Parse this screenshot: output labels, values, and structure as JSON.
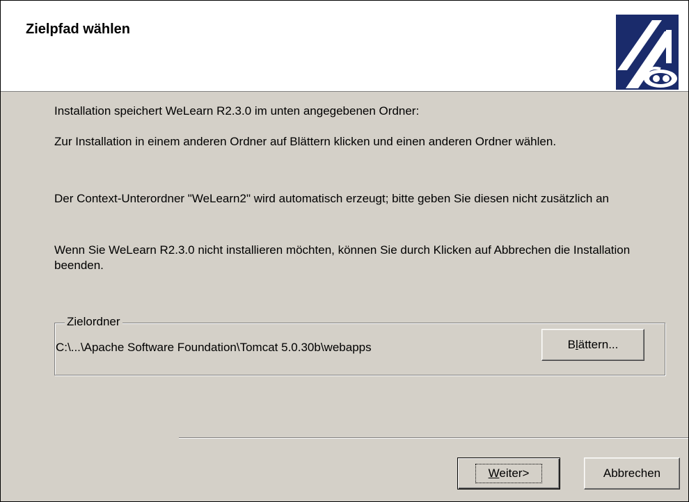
{
  "header": {
    "title": "Zielpfad wählen"
  },
  "body": {
    "paragraphs": [
      "Installation speichert WeLearn R2.3.0 im unten angegebenen Ordner:",
      "Zur Installation in einem anderen Ordner auf Blättern klicken und einen anderen Ordner wählen.",
      "Der Context-Unterordner \"WeLearn2\" wird automatisch erzeugt; bitte geben Sie diesen nicht zusätzlich an",
      "Wenn Sie WeLearn R2.3.0 nicht installieren möchten, können Sie durch Klicken auf Abbrechen die Installation beenden."
    ]
  },
  "destination": {
    "legend": "Zielordner",
    "path": "C:\\...\\Apache Software Foundation\\Tomcat 5.0.30b\\webapps",
    "browse_label_pre": "B",
    "browse_label_mnemonic": "l",
    "browse_label_post": "ättern..."
  },
  "footer": {
    "next_label_mnemonic": "W",
    "next_label_post": "eiter>",
    "cancel_label": "Abbrechen"
  },
  "colors": {
    "dialog_bg": "#d4d0c8",
    "header_bg": "#ffffff",
    "logo_bg": "#1a2b6b"
  },
  "icons": {
    "logo": "installer-logo-icon"
  }
}
